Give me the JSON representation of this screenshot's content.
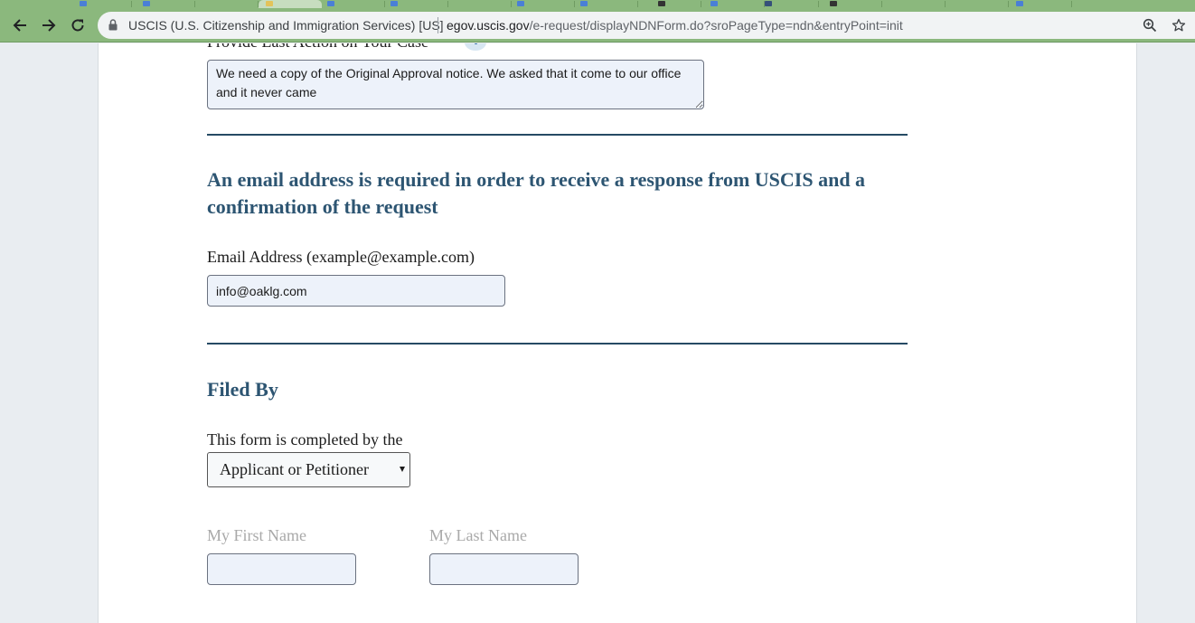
{
  "browser": {
    "site_name": "USCIS (U.S. Citizenship and Immigration Services) [US]",
    "url_host": "egov.uscis.gov",
    "url_path": "/e-request/displayNDNForm.do?sroPageType=ndn&entryPoint=init",
    "theme_color": "#8bb87d"
  },
  "form": {
    "last_action_label": "Provide Last Action on Your Case",
    "last_action_value": "We need a copy of the Original Approval notice. We asked that it come to our office and it never came",
    "email_section_heading": "An email address is required in order to receive a response from USCIS and a confirmation of the request",
    "email_label": "Email Address (example@example.com)",
    "email_value": "info@oaklg.com",
    "filed_by_heading": "Filed By",
    "completed_by_label": "This form is completed by the",
    "completed_by_selected": "Applicant or Petitioner",
    "first_name_label": "My First Name",
    "first_name_value": "",
    "last_name_label": "My Last Name",
    "last_name_value": ""
  },
  "colors": {
    "heading": "#2d5572",
    "rule": "#264a64",
    "input_bg": "#edf2fa"
  }
}
